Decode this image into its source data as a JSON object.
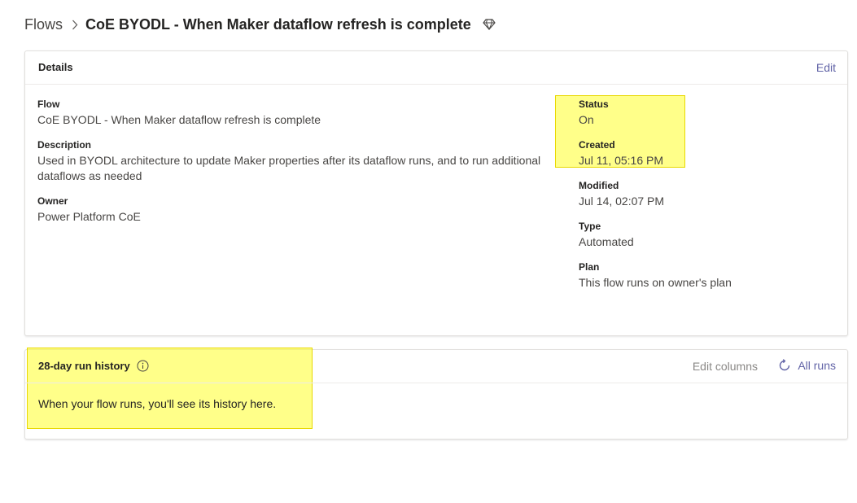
{
  "breadcrumb": {
    "root": "Flows",
    "current": "CoE BYODL - When Maker dataflow refresh is complete",
    "premium_icon": "diamond-icon"
  },
  "details": {
    "title": "Details",
    "edit_label": "Edit",
    "left_fields": [
      {
        "label": "Flow",
        "value": "CoE BYODL - When Maker dataflow refresh is complete"
      },
      {
        "label": "Description",
        "value_line1": "Used in BYODL architecture to update Maker properties after its dataflow runs, and to run additional",
        "value_line2": "dataflows as needed"
      },
      {
        "label": "Owner",
        "value": "Power Platform CoE"
      }
    ],
    "right_fields": [
      {
        "label": "Status",
        "value": "On"
      },
      {
        "label": "Created",
        "value": "Jul 11, 05:16 PM"
      },
      {
        "label": "Modified",
        "value": "Jul 14, 02:07 PM"
      },
      {
        "label": "Type",
        "value": "Automated"
      },
      {
        "label": "Plan",
        "value": "This flow runs on owner's plan"
      }
    ]
  },
  "history": {
    "title": "28-day run history",
    "info_icon": "info-icon",
    "edit_columns_label": "Edit columns",
    "all_runs_label": "All runs",
    "all_runs_icon": "refresh-icon",
    "empty_message": "When your flow runs, you'll see its history here."
  },
  "colors": {
    "accent": "#6264a7",
    "highlight": "#ffff28"
  }
}
